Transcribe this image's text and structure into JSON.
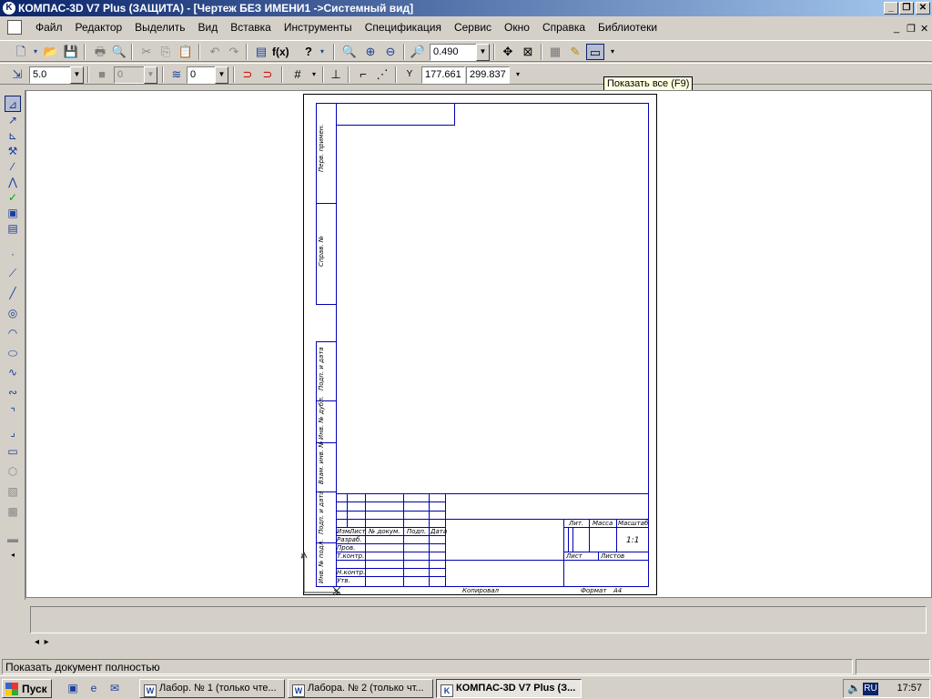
{
  "window": {
    "title": "КОМПАС-3D V7 Plus (ЗАЩИТА) - [Чертеж БЕЗ ИМЕНИ1 ->Системный вид]",
    "minimize": "_",
    "restore": "❐",
    "close": "✕"
  },
  "menu": {
    "items": [
      "Файл",
      "Редактор",
      "Выделить",
      "Вид",
      "Вставка",
      "Инструменты",
      "Спецификация",
      "Сервис",
      "Окно",
      "Справка",
      "Библиотеки"
    ]
  },
  "toolbar1": {
    "zoom_value": "0.490"
  },
  "toolbar2": {
    "step_value": "5.0",
    "style_value": "0",
    "layer_value": "0",
    "coord_x": "177.661",
    "coord_y": "299.837"
  },
  "tooltip": "Показать все (F9)",
  "sheet": {
    "side_labels": [
      "Перв. примен.",
      "Справ. №",
      "Подп. и дата",
      "Инв. № дубл.",
      "Взам. инв. №",
      "Подп. и дата",
      "Инв. № подл."
    ],
    "col_headers": [
      "Изм.",
      "Лист",
      "№ докум.",
      "Подп.",
      "Дата"
    ],
    "row_labels": [
      "Разраб.",
      "Пров.",
      "Т.контр.",
      "Н.контр.",
      "Утв."
    ],
    "lit_header": "Лит.",
    "mass_header": "Масса",
    "scale_header": "Масштаб",
    "scale_value": "1:1",
    "sheet_label": "Лист",
    "sheets_label": "Листов",
    "copied": "Копировал",
    "format_label": "Формат",
    "format_value": "A4"
  },
  "status": {
    "message": "Показать документ полностью"
  },
  "taskbar": {
    "start": "Пуск",
    "buttons": [
      "Лабор. № 1 (только чте...",
      "Лабора. № 2 (только чт...",
      "КОМПАС-3D V7 Plus (З..."
    ],
    "lang": "RU",
    "clock": "17:57"
  }
}
